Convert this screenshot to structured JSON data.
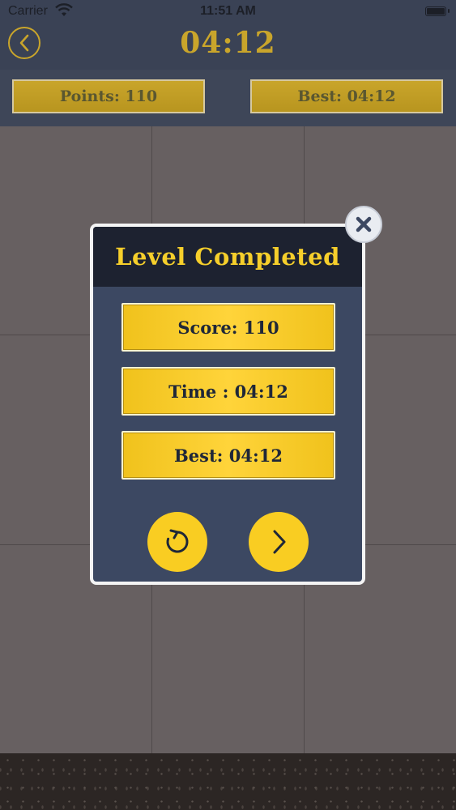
{
  "status_bar": {
    "carrier": "Carrier",
    "time": "11:51 AM"
  },
  "header": {
    "timer": "04:12",
    "back_icon": "chevron-left-icon"
  },
  "top_bar": {
    "points_label": "Points: 110",
    "best_label": "Best: 04:12"
  },
  "modal": {
    "title": "Level Completed",
    "score_label": "Score: 110",
    "time_label": "Time : 04:12",
    "best_label": "Best: 04:12",
    "close_icon": "close-icon",
    "restart_icon": "restart-icon",
    "next_icon": "chevron-right-icon"
  },
  "colors": {
    "accent_gold": "#c9a52b",
    "button_yellow": "#f9cd22",
    "modal_bg": "#3c4862",
    "modal_header": "#1d2230",
    "grid_bg": "#676061"
  }
}
